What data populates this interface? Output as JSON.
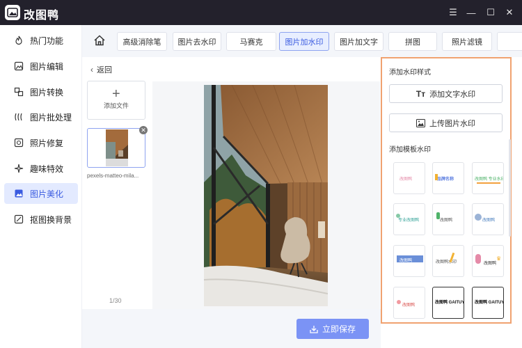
{
  "app": {
    "title": "改图鸭"
  },
  "window_controls": [
    {
      "name": "menu-icon",
      "glyph": "☰"
    },
    {
      "name": "minimize-icon",
      "glyph": "—"
    },
    {
      "name": "maximize-icon",
      "glyph": "☐"
    },
    {
      "name": "close-icon",
      "glyph": "✕"
    }
  ],
  "sidebar": {
    "items": [
      {
        "label": "热门功能",
        "icon": "flame-icon"
      },
      {
        "label": "图片编辑",
        "icon": "image-edit-icon"
      },
      {
        "label": "图片转换",
        "icon": "convert-icon"
      },
      {
        "label": "图片批处理",
        "icon": "batch-icon"
      },
      {
        "label": "照片修复",
        "icon": "repair-icon"
      },
      {
        "label": "趣味特效",
        "icon": "sparkle-icon"
      },
      {
        "label": "图片美化",
        "icon": "beautify-icon",
        "active": true
      },
      {
        "label": "抠图换背景",
        "icon": "cutout-icon"
      }
    ]
  },
  "toolbar": {
    "tabs": [
      {
        "label": "高级消除笔"
      },
      {
        "label": "图片去水印"
      },
      {
        "label": "马赛克"
      },
      {
        "label": "图片加水印",
        "active": true
      },
      {
        "label": "图片加文字"
      },
      {
        "label": "拼图"
      },
      {
        "label": "照片滤镜"
      }
    ]
  },
  "left": {
    "back_label": "返回",
    "add_file_label": "添加文件",
    "file_name": "pexels-matteo-mila...",
    "page_count": "1/30"
  },
  "footer": {
    "save_label": "立即保存"
  },
  "panel": {
    "style_title": "添加水印样式",
    "add_text_label": "添加文字水印",
    "upload_image_label": "上传图片水印",
    "template_title": "添加模板水印",
    "templates": [
      {
        "text": "改图鸭"
      },
      {
        "text": "品牌名称"
      },
      {
        "text": "改图鸭 专业水印"
      },
      {
        "text": "专业改图鸭"
      },
      {
        "text": "改图鸭"
      },
      {
        "text": "改图鸭"
      },
      {
        "text": "改图鸭"
      },
      {
        "text": "改图鸭水印"
      },
      {
        "text": "改图鸭"
      },
      {
        "text": "改图鸭"
      },
      {
        "text": "改图鸭 GAITUYA"
      },
      {
        "text": "改图鸭 GAITUYA"
      }
    ]
  },
  "colors": {
    "accent": "#3a5be0",
    "titlebar": "#23212c",
    "highlight_border": "#f0a270",
    "save_button": "#7b93f5"
  }
}
